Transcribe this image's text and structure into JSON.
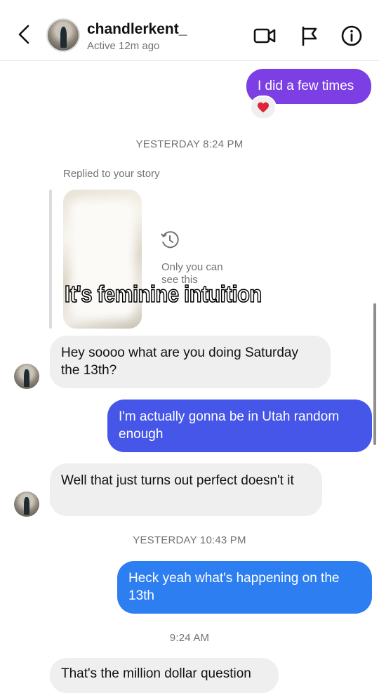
{
  "header": {
    "username": "chandlerkent_",
    "status": "Active 12m ago"
  },
  "colors": {
    "out_top": "#7B3FE4",
    "out_mid": "#4556E8",
    "out_bottom": "#2D7EF0",
    "incoming": "#EFEFEF",
    "heart": "#E0243A"
  },
  "messages": {
    "m1": "I did a few times",
    "m1_reaction": "heart",
    "ts1": "YESTERDAY 8:24 PM",
    "replied_label": "Replied to your story",
    "story_notice": "Only you can see this",
    "story_caption": "It's feminine intuition",
    "m2": "Hey soooo what are you doing Saturday the 13th?",
    "m3": "I'm actually gonna be in Utah random enough",
    "m4": "Well that just turns out perfect doesn't it",
    "ts2": "YESTERDAY 10:43 PM",
    "m5": "Heck yeah what's happening on the 13th",
    "ts3": "9:24 AM",
    "m6": "That's the million dollar question"
  }
}
